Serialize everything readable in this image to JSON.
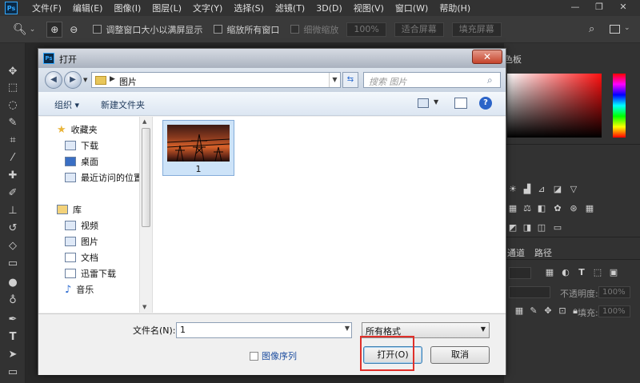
{
  "app": {
    "logo": "Ps"
  },
  "menubar": {
    "items": [
      "文件(F)",
      "编辑(E)",
      "图像(I)",
      "图层(L)",
      "文字(Y)",
      "选择(S)",
      "滤镜(T)",
      "3D(D)",
      "视图(V)",
      "窗口(W)",
      "帮助(H)"
    ],
    "window_controls": [
      "minimize-icon",
      "restore-icon",
      "close-icon"
    ]
  },
  "options_bar": {
    "resize_windows_label": "调整窗口大小以满屏显示",
    "zoom_all_windows_label": "缩放所有窗口",
    "scrubby_zoom_label": "细微缩放",
    "zoom_value": "100%",
    "fit_screen_label": "适合屏幕",
    "fill_screen_label": "填充屏幕"
  },
  "right_panel": {
    "color_tab": "色板",
    "channels_tab": "通道",
    "paths_tab": "路径",
    "opacity_label": "不透明度:",
    "opacity_value": "100%",
    "fill_label": "填充:",
    "fill_value": "100%"
  },
  "dialog": {
    "title": "打开",
    "address": {
      "current_folder": "图片"
    },
    "search_placeholder": "搜索 图片",
    "toolbar": {
      "organize_label": "组织 ▾",
      "new_folder_label": "新建文件夹"
    },
    "nav_pane": {
      "favorites_header": "收藏夹",
      "favorites": [
        "下载",
        "桌面",
        "最近访问的位置"
      ],
      "libraries_header": "库",
      "libraries": [
        "视频",
        "图片",
        "文档",
        "迅雷下载",
        "音乐"
      ]
    },
    "files": [
      {
        "name": "1"
      }
    ],
    "filename_label": "文件名(N):",
    "filename_value": "1",
    "filetype_value": "所有格式",
    "image_sequence_label": "图像序列",
    "open_button": "打开(O)",
    "cancel_button": "取消"
  },
  "colors": {
    "highlight": "#e0302a",
    "ps_blue": "#31a8ff"
  }
}
